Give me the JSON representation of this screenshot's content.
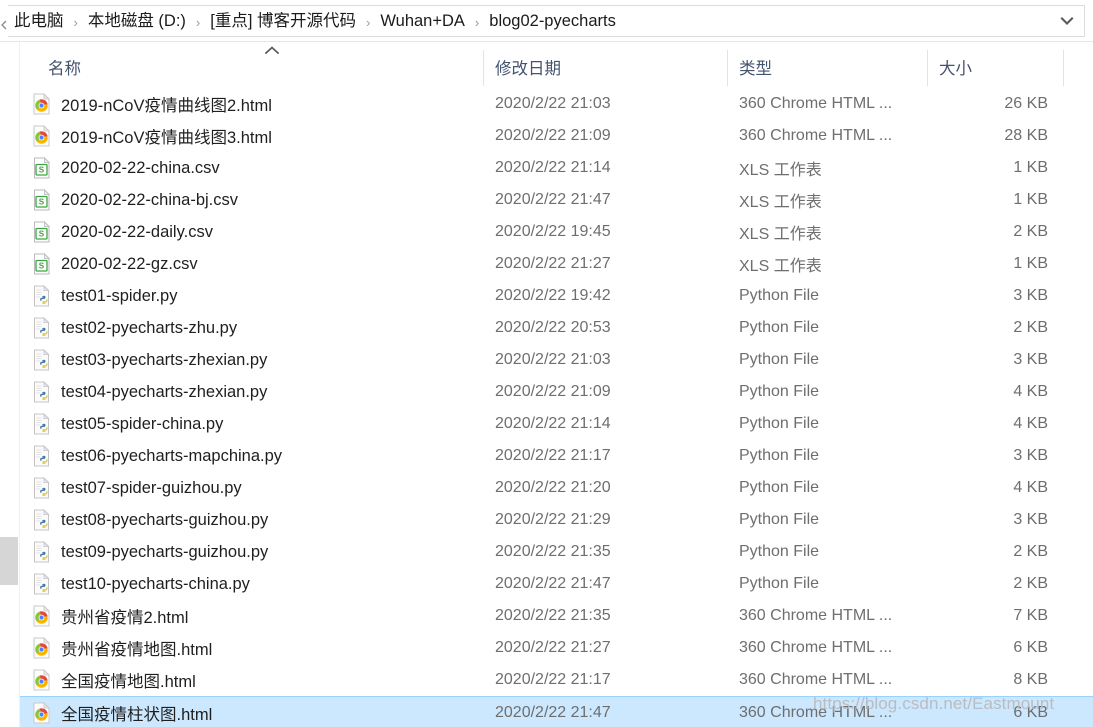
{
  "address_bar": {
    "back_arrow_icon": "chevron-left-icon",
    "dropdown_icon": "chevron-down-icon",
    "separator": "›",
    "breadcrumbs": [
      "此电脑",
      "本地磁盘 (D:)",
      "[重点] 博客开源代码",
      "Wuhan+DA",
      "blog02-pyecharts"
    ]
  },
  "columns": {
    "name": "名称",
    "date_modified": "修改日期",
    "type": "类型",
    "size": "大小",
    "sort_indicator": "ascending"
  },
  "colors": {
    "selection_fill": "#cce8ff",
    "selection_border": "#99d1ff",
    "header_text": "#44546f",
    "secondary_text": "#6e6e6e",
    "watermark": "#b9bcc2"
  },
  "files": [
    {
      "name": "2019-nCoV疫情曲线图2.html",
      "date": "2020/2/22 21:03",
      "type": "360 Chrome HTML ...",
      "size": "26 KB",
      "icon": "chrome-html-file-icon",
      "selected": false
    },
    {
      "name": "2019-nCoV疫情曲线图3.html",
      "date": "2020/2/22 21:09",
      "type": "360 Chrome HTML ...",
      "size": "28 KB",
      "icon": "chrome-html-file-icon",
      "selected": false
    },
    {
      "name": "2020-02-22-china.csv",
      "date": "2020/2/22 21:14",
      "type": "XLS 工作表",
      "size": "1 KB",
      "icon": "csv-spreadsheet-file-icon",
      "selected": false
    },
    {
      "name": "2020-02-22-china-bj.csv",
      "date": "2020/2/22 21:47",
      "type": "XLS 工作表",
      "size": "1 KB",
      "icon": "csv-spreadsheet-file-icon",
      "selected": false
    },
    {
      "name": "2020-02-22-daily.csv",
      "date": "2020/2/22 19:45",
      "type": "XLS 工作表",
      "size": "2 KB",
      "icon": "csv-spreadsheet-file-icon",
      "selected": false
    },
    {
      "name": "2020-02-22-gz.csv",
      "date": "2020/2/22 21:27",
      "type": "XLS 工作表",
      "size": "1 KB",
      "icon": "csv-spreadsheet-file-icon",
      "selected": false
    },
    {
      "name": "test01-spider.py",
      "date": "2020/2/22 19:42",
      "type": "Python File",
      "size": "3 KB",
      "icon": "python-file-icon",
      "selected": false
    },
    {
      "name": "test02-pyecharts-zhu.py",
      "date": "2020/2/22 20:53",
      "type": "Python File",
      "size": "2 KB",
      "icon": "python-file-icon",
      "selected": false
    },
    {
      "name": "test03-pyecharts-zhexian.py",
      "date": "2020/2/22 21:03",
      "type": "Python File",
      "size": "3 KB",
      "icon": "python-file-icon",
      "selected": false
    },
    {
      "name": "test04-pyecharts-zhexian.py",
      "date": "2020/2/22 21:09",
      "type": "Python File",
      "size": "4 KB",
      "icon": "python-file-icon",
      "selected": false
    },
    {
      "name": "test05-spider-china.py",
      "date": "2020/2/22 21:14",
      "type": "Python File",
      "size": "4 KB",
      "icon": "python-file-icon",
      "selected": false
    },
    {
      "name": "test06-pyecharts-mapchina.py",
      "date": "2020/2/22 21:17",
      "type": "Python File",
      "size": "3 KB",
      "icon": "python-file-icon",
      "selected": false
    },
    {
      "name": "test07-spider-guizhou.py",
      "date": "2020/2/22 21:20",
      "type": "Python File",
      "size": "4 KB",
      "icon": "python-file-icon",
      "selected": false
    },
    {
      "name": "test08-pyecharts-guizhou.py",
      "date": "2020/2/22 21:29",
      "type": "Python File",
      "size": "3 KB",
      "icon": "python-file-icon",
      "selected": false
    },
    {
      "name": "test09-pyecharts-guizhou.py",
      "date": "2020/2/22 21:35",
      "type": "Python File",
      "size": "2 KB",
      "icon": "python-file-icon",
      "selected": false
    },
    {
      "name": "test10-pyecharts-china.py",
      "date": "2020/2/22 21:47",
      "type": "Python File",
      "size": "2 KB",
      "icon": "python-file-icon",
      "selected": false
    },
    {
      "name": "贵州省疫情2.html",
      "date": "2020/2/22 21:35",
      "type": "360 Chrome HTML ...",
      "size": "7 KB",
      "icon": "chrome-html-file-icon",
      "selected": false
    },
    {
      "name": "贵州省疫情地图.html",
      "date": "2020/2/22 21:27",
      "type": "360 Chrome HTML ...",
      "size": "6 KB",
      "icon": "chrome-html-file-icon",
      "selected": false
    },
    {
      "name": "全国疫情地图.html",
      "date": "2020/2/22 21:17",
      "type": "360 Chrome HTML ...",
      "size": "8 KB",
      "icon": "chrome-html-file-icon",
      "selected": false
    },
    {
      "name": "全国疫情柱状图.html",
      "date": "2020/2/22 21:47",
      "type": "360 Chrome HTML ...",
      "size": "6 KB",
      "icon": "chrome-html-file-icon",
      "selected": true
    }
  ],
  "watermark": {
    "text": "https://blog.csdn.net/Eastmount"
  }
}
